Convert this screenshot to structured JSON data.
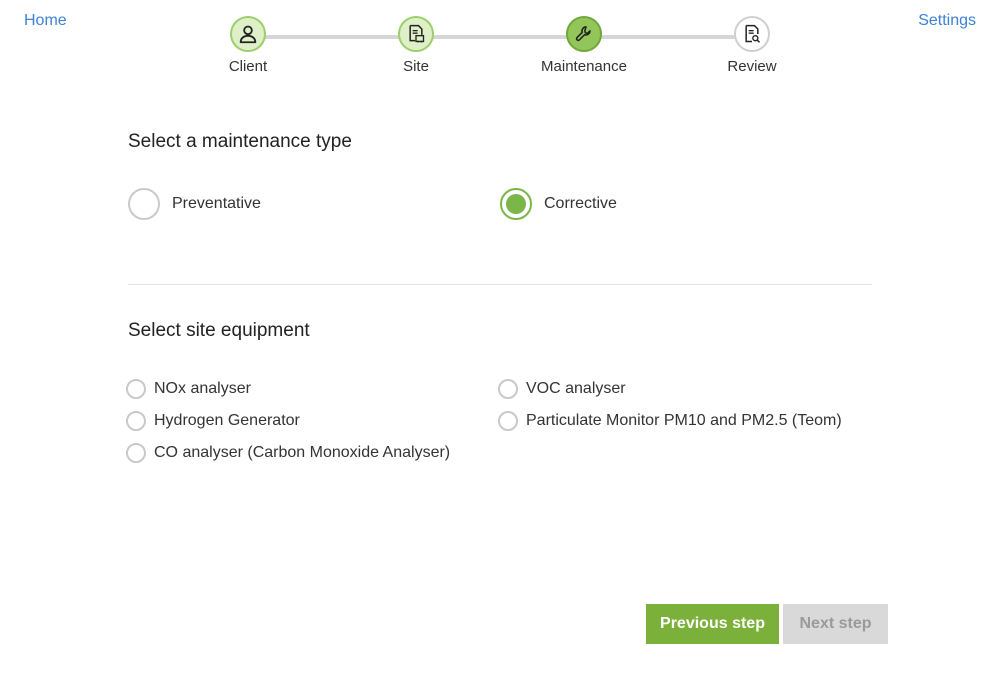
{
  "nav": {
    "home_label": "Home",
    "settings_label": "Settings"
  },
  "stepper": {
    "steps": [
      {
        "label": "Client",
        "icon": "user-icon",
        "state": "done"
      },
      {
        "label": "Site",
        "icon": "site-document-icon",
        "state": "done"
      },
      {
        "label": "Maintenance",
        "icon": "wrench-icon",
        "state": "active"
      },
      {
        "label": "Review",
        "icon": "document-search-icon",
        "state": "pending"
      }
    ]
  },
  "maintenance_type": {
    "title": "Select a maintenance type",
    "options": [
      {
        "label": "Preventative",
        "selected": false
      },
      {
        "label": "Corrective",
        "selected": true
      }
    ]
  },
  "site_equipment": {
    "title": "Select site equipment",
    "items": [
      {
        "label": "NOx analyser",
        "checked": false
      },
      {
        "label": "Hydrogen Generator",
        "checked": false
      },
      {
        "label": "CO analyser (Carbon Monoxide Analyser)",
        "checked": false
      },
      {
        "label": "VOC analyser",
        "checked": false
      },
      {
        "label": "Particulate Monitor PM10 and PM2.5 (Teom)",
        "checked": false
      }
    ]
  },
  "buttons": {
    "previous_label": "Previous step",
    "next_label": "Next step",
    "next_enabled": false
  },
  "colors": {
    "accent_green": "#7bb13a",
    "link_blue": "#3b82d6",
    "disabled_gray": "#d9d9d9"
  }
}
